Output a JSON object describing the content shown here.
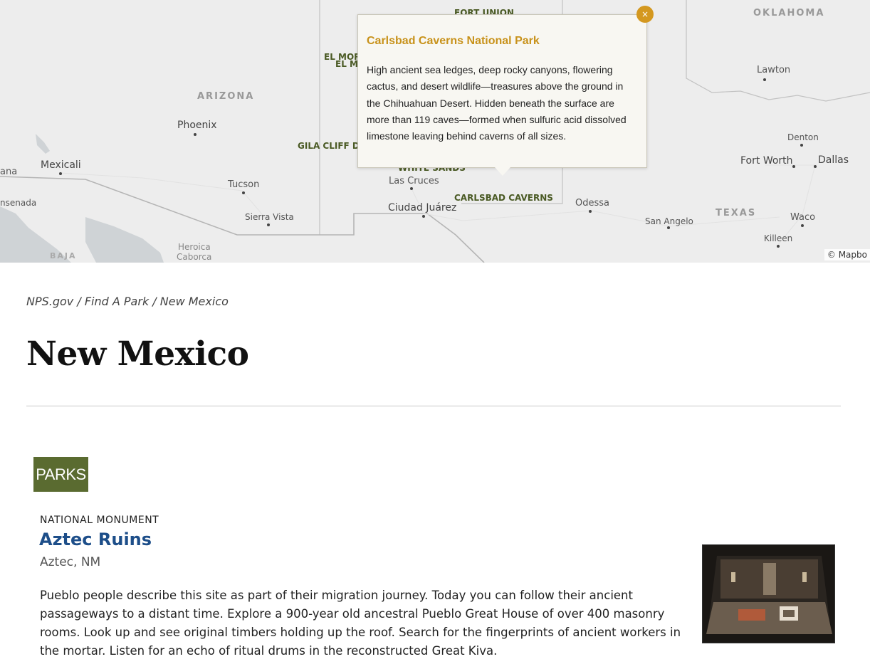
{
  "map": {
    "regions": {
      "oklahoma": "OKLAHOMA",
      "arizona": "ARIZONA",
      "texas": "TEXAS",
      "baja": "BAJA"
    },
    "cities": {
      "lawton": "Lawton",
      "phoenix": "Phoenix",
      "mexicali": "Mexicali",
      "ana": "ana",
      "senada": "nsenada",
      "tucson": "Tucson",
      "sierra_vista": "Sierra Vista",
      "heroica": "Heroica",
      "caborca": "Caborca",
      "las_cruces": "Las Cruces",
      "ciudad_juarez": "Ciudad Juárez",
      "odessa": "Odessa",
      "san_angelo": "San Angelo",
      "fort_worth": "Fort Worth",
      "dallas": "Dallas",
      "denton": "Denton",
      "waco": "Waco",
      "killeen": "Killeen"
    },
    "parks": {
      "fort_union": "FORT UNION",
      "el_morro": "EL MOR",
      "el_malpais": "EL M",
      "gila": "GILA CLIFF D",
      "white_sands": "WHITE SANDS",
      "carlsbad": "CARLSBAD CAVERNS"
    },
    "attribution": "© Mapbo",
    "popup": {
      "title": "Carlsbad Caverns National Park",
      "body": "High ancient sea ledges, deep rocky canyons, flowering cactus, and desert wildlife—treasures above the ground in the Chihuahuan Desert. Hidden beneath the surface are more than 119 caves—formed when sulfuric acid dissolved limestone leaving behind caverns of all sizes.",
      "close_label": "×"
    }
  },
  "breadcrumb": {
    "items": [
      "NPS.gov",
      "Find A Park",
      "New Mexico"
    ],
    "separator": " / "
  },
  "page": {
    "title": "New Mexico"
  },
  "section": {
    "badge": "PARKS"
  },
  "park": {
    "type": "NATIONAL MONUMENT",
    "name": "Aztec Ruins",
    "location": "Aztec, NM",
    "description": "Pueblo people describe this site as part of their migration journey. Today you can follow their ancient passageways to a distant time. Explore a 900-year old ancestral Pueblo Great House of over 400 masonry rooms. Look up and see original timbers holding up the roof. Search for the fingerprints of ancient workers in the mortar. Listen for an echo of ritual drums in the reconstructed Great Kiva."
  },
  "colors": {
    "popup_title": "#c8921b",
    "close_button": "#d4981f",
    "park_link": "#1d4e89",
    "badge": "#5a6b30",
    "park_label": "#4a5a24"
  }
}
